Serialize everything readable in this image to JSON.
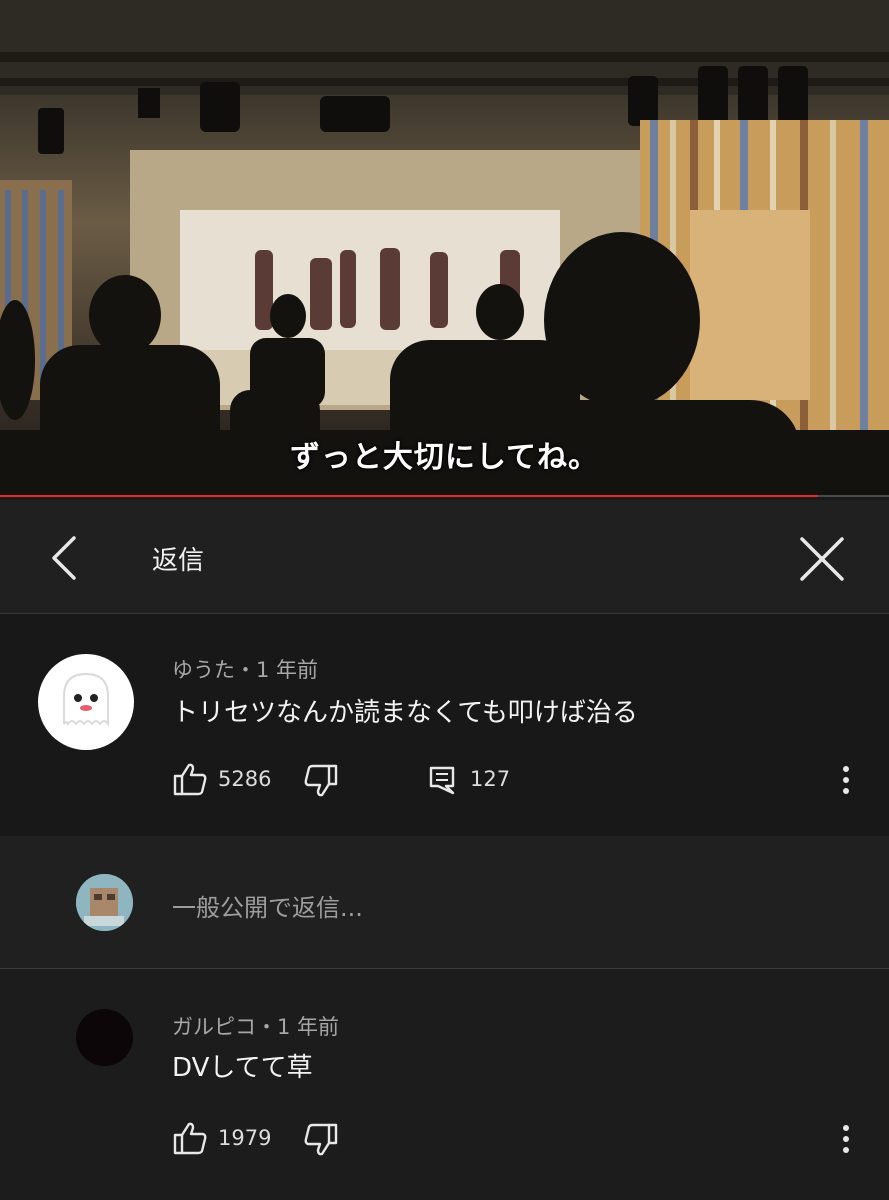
{
  "video": {
    "subtitle": "ずっと大切にしてね。",
    "progress": 0.92
  },
  "header": {
    "title": "返信",
    "back_icon": "chevron-left-icon",
    "close_icon": "close-icon"
  },
  "main_comment": {
    "author": "ゆうた",
    "time": "1 年前",
    "meta": "ゆうた・1 年前",
    "text": "トリセツなんか読まなくても叩けば治る",
    "likes": "5286",
    "replies": "127",
    "avatar_icon": "ghost-avatar-icon"
  },
  "reply_input": {
    "placeholder": "一般公開で返信..."
  },
  "reply_comment": {
    "author": "ガルピコ",
    "time": "1 年前",
    "meta": "ガルピコ・1 年前",
    "text": "DVしてて草",
    "likes": "1979"
  },
  "colors": {
    "progress": "#e52a2a",
    "background": "#181818",
    "header": "#202020"
  }
}
